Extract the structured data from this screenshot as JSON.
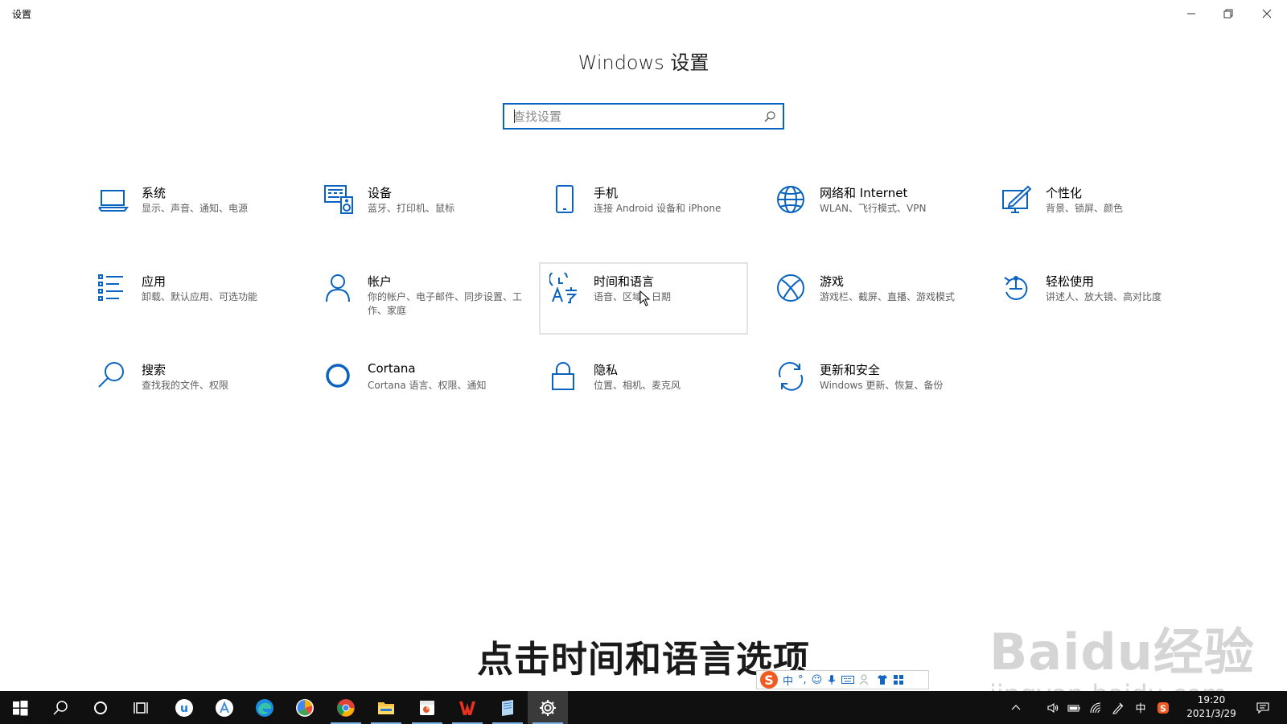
{
  "window": {
    "app_title": "设置",
    "page_title": "Windows 设置"
  },
  "search": {
    "placeholder": "查找设置"
  },
  "tiles": [
    {
      "title": "系统",
      "desc": "显示、声音、通知、电源",
      "icon": "laptop-icon"
    },
    {
      "title": "设备",
      "desc": "蓝牙、打印机、鼠标",
      "icon": "devices-icon"
    },
    {
      "title": "手机",
      "desc": "连接 Android 设备和 iPhone",
      "icon": "phone-icon"
    },
    {
      "title": "网络和 Internet",
      "desc": "WLAN、飞行模式、VPN",
      "icon": "globe-icon"
    },
    {
      "title": "个性化",
      "desc": "背景、锁屏、颜色",
      "icon": "personalization-icon"
    },
    {
      "title": "应用",
      "desc": "卸载、默认应用、可选功能",
      "icon": "apps-list-icon"
    },
    {
      "title": "帐户",
      "desc": "你的帐户、电子邮件、同步设置、工作、家庭",
      "icon": "person-icon"
    },
    {
      "title": "时间和语言",
      "desc": "语音、区域、日期",
      "icon": "time-language-icon"
    },
    {
      "title": "游戏",
      "desc": "游戏栏、截屏、直播、游戏模式",
      "icon": "xbox-icon"
    },
    {
      "title": "轻松使用",
      "desc": "讲述人、放大镜、高对比度",
      "icon": "ease-of-access-icon"
    },
    {
      "title": "搜索",
      "desc": "查找我的文件、权限",
      "icon": "search-icon"
    },
    {
      "title": "Cortana",
      "desc": "Cortana 语言、权限、通知",
      "icon": "cortana-icon"
    },
    {
      "title": "隐私",
      "desc": "位置、相机、麦克风",
      "icon": "lock-icon"
    },
    {
      "title": "更新和安全",
      "desc": "Windows 更新、恢复、备份",
      "icon": "sync-icon"
    }
  ],
  "subtitle": "点击时间和语言选项",
  "watermark": {
    "logo": "Baidu经验",
    "url": "jingyan.baidu.com"
  },
  "ime": {
    "logo": "S",
    "lang": "中",
    "punct": "°,"
  },
  "taskbar": {
    "tray_lang": "中",
    "time": "19:20",
    "date": "2021/3/29"
  },
  "colors": {
    "accent": "#0a63c1",
    "icon_blue": "#0a63c1",
    "taskbar": "#101010"
  }
}
